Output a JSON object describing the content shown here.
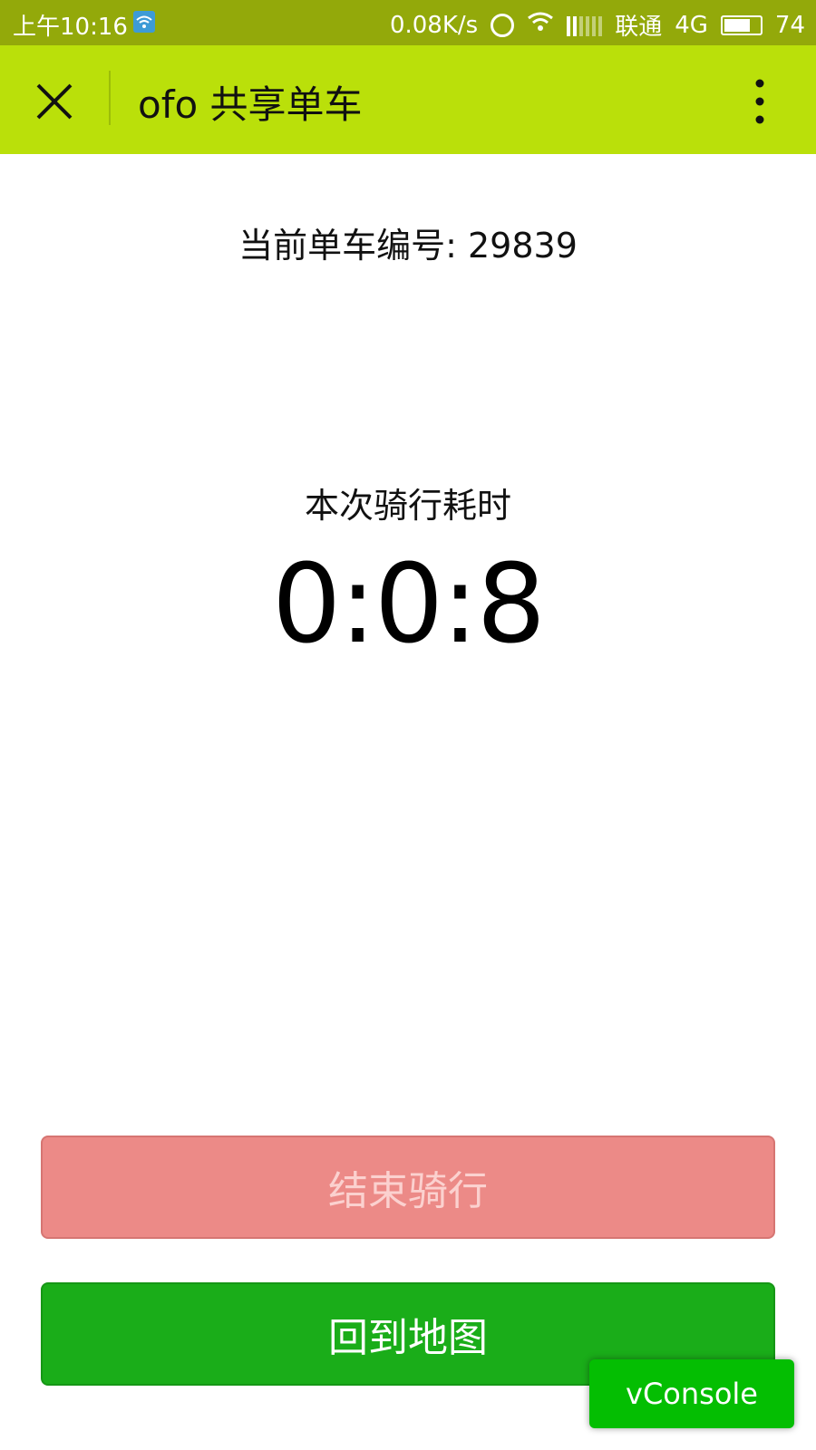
{
  "status_bar": {
    "time": "上午10:16",
    "net_speed": "0.08K/s",
    "carrier": "联通",
    "network": "4G",
    "battery": "74",
    "battery_level": 0.74
  },
  "nav": {
    "title": "ofo 共享单车"
  },
  "ride": {
    "bike_number_label": "当前单车编号:",
    "bike_number": "29839",
    "duration_label": "本次骑行耗时",
    "duration_value": "0:0:8"
  },
  "buttons": {
    "end_ride": "结束骑行",
    "back_to_map": "回到地图"
  },
  "vconsole": {
    "label": "vConsole"
  },
  "colors": {
    "status_bar_bg": "#93a90a",
    "nav_bar_bg": "#bae00a",
    "end_button_bg": "#ec8a87",
    "map_button_bg": "#1aad19",
    "vconsole_bg": "#04be02"
  },
  "icons": [
    "wifi-icon",
    "alarm-icon",
    "signal-icon",
    "battery-icon",
    "close-icon",
    "more-vertical-icon"
  ]
}
